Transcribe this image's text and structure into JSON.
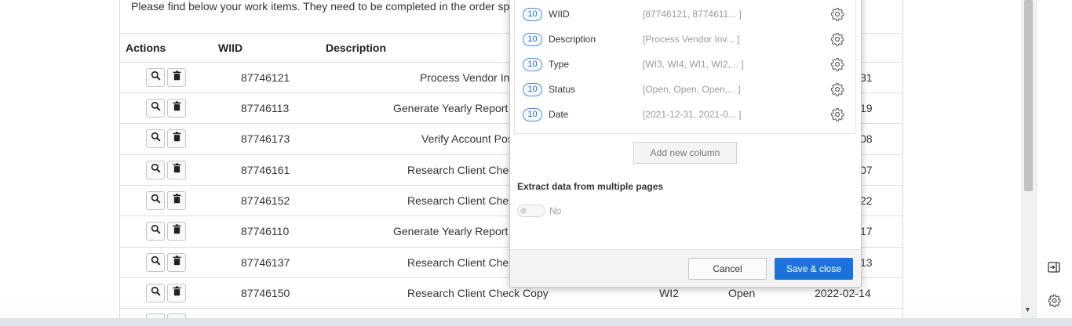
{
  "page": {
    "intro_text": "Please find below your work items. They need to be completed in the order sp",
    "headers": {
      "actions": "Actions",
      "wiid": "WIID",
      "description": "Description"
    },
    "rows": [
      {
        "wiid": "87746121",
        "description": "Process Vendor In",
        "date_tail": "31"
      },
      {
        "wiid": "87746113",
        "description": "Generate Yearly Report",
        "date_tail": "19"
      },
      {
        "wiid": "87746173",
        "description": "Verify Account Pos",
        "date_tail": "08"
      },
      {
        "wiid": "87746161",
        "description": "Research Client Chec",
        "date_tail": "07"
      },
      {
        "wiid": "87746152",
        "description": "Research Client Che",
        "date_tail": "22"
      },
      {
        "wiid": "87746110",
        "description": "Generate Yearly Report",
        "date_tail": "17"
      },
      {
        "wiid": "87746137",
        "description": "Research Client Che",
        "date_tail": "13"
      },
      {
        "wiid": "87746150",
        "description": "Research Client Check Copy",
        "type": "WI2",
        "status": "Open",
        "date": "2022-02-14"
      }
    ]
  },
  "dialog": {
    "columns": [
      {
        "count": "10",
        "name": "WIID",
        "sample": "[87746121, 8774611... ]"
      },
      {
        "count": "10",
        "name": "Description",
        "sample": "[Process Vendor Inv... ]"
      },
      {
        "count": "10",
        "name": "Type",
        "sample": "[WI3, WI4, WI1, WI2,... ]"
      },
      {
        "count": "10",
        "name": "Status",
        "sample": "[Open, Open, Open,... ]"
      },
      {
        "count": "10",
        "name": "Date",
        "sample": "[2021-12-31, 2021-0... ]"
      }
    ],
    "add_column_label": "Add new column",
    "extract_label": "Extract data from multiple pages",
    "toggle_value": "No",
    "cancel_label": "Cancel",
    "save_label": "Save & close"
  },
  "icons": {
    "row_view": "search-icon",
    "row_delete": "trash-icon",
    "column_settings": "gear-icon",
    "rail_top": "panel-expand-icon",
    "rail_bottom": "settings-icon"
  },
  "colors": {
    "accent": "#1a73d9",
    "badge_border": "#4f8fd6"
  }
}
